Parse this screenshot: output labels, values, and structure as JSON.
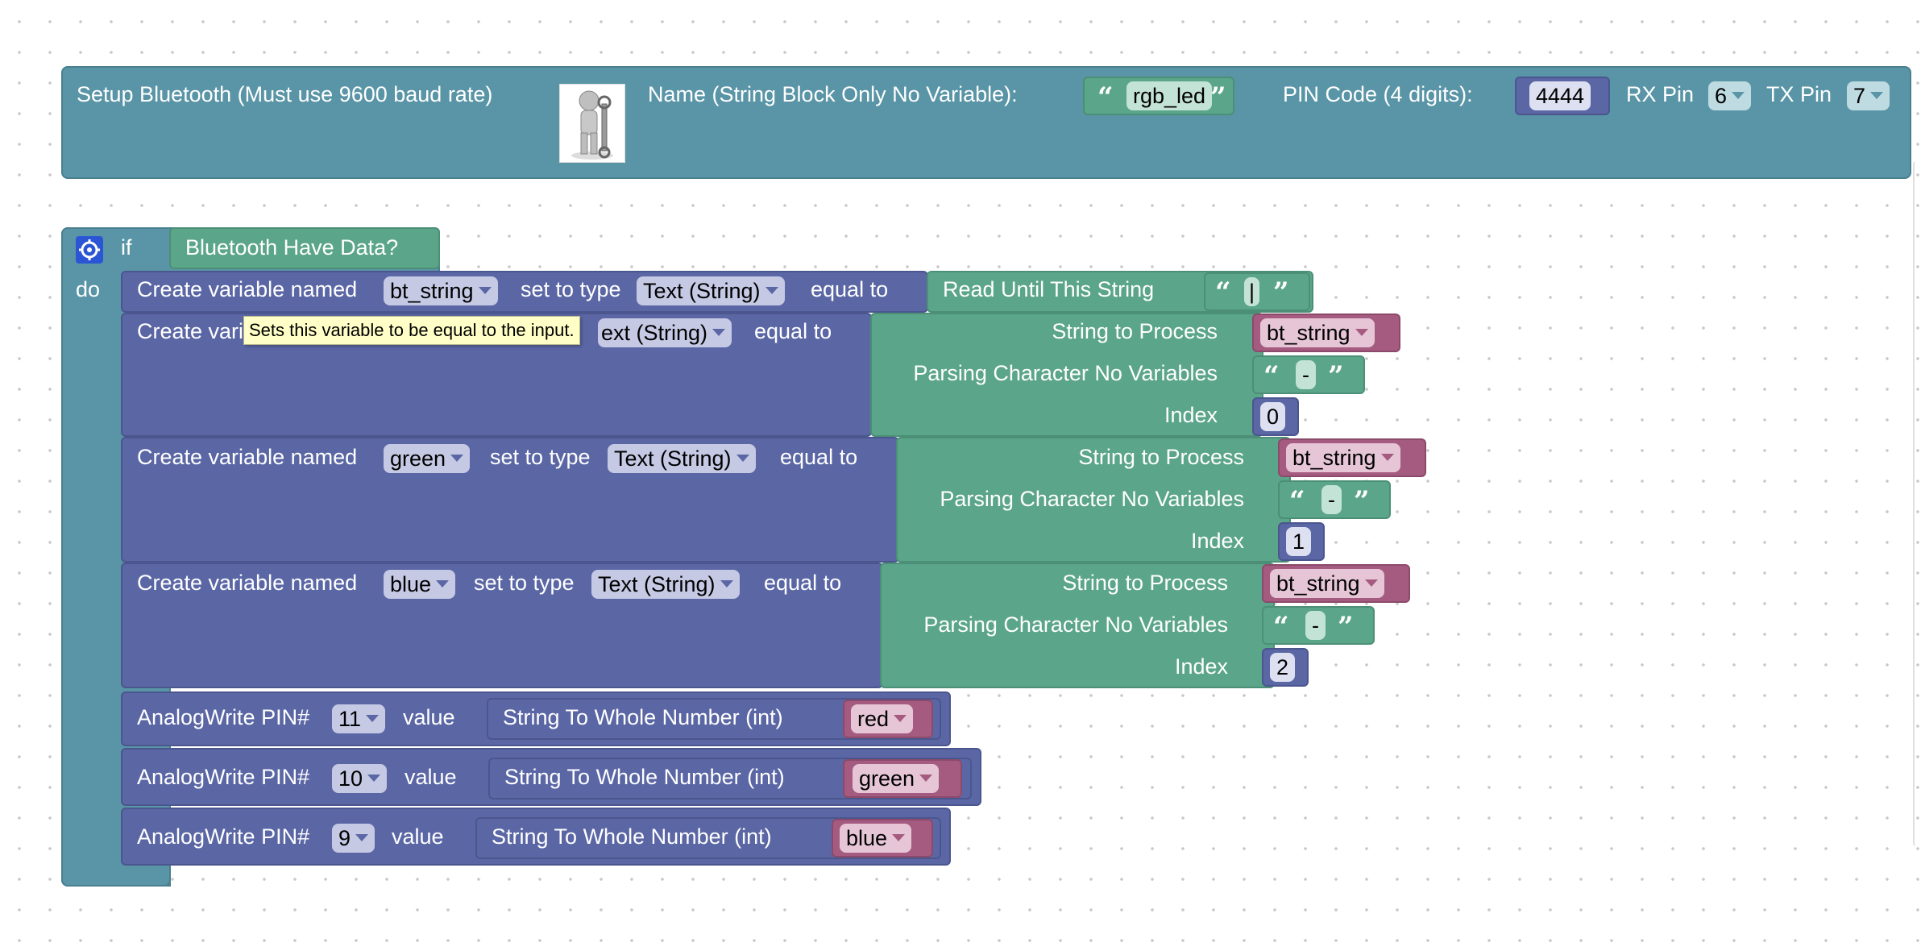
{
  "bluetooth_setup": {
    "title": "Setup Bluetooth (Must use 9600 baud rate)",
    "name_label": "Name (String Block Only No Variable):",
    "name_value": "rgb_led",
    "pin_code_label": "PIN Code (4 digits):",
    "pin_code_value": "4444",
    "rx_label": "RX Pin",
    "rx_value": "6",
    "tx_label": "TX Pin",
    "tx_value": "7"
  },
  "if_block": {
    "if_label": "if",
    "do_label": "do",
    "condition": "Bluetooth Have Data?"
  },
  "create_label": "Create variable named",
  "create_label_clipped": "Create vari",
  "set_type_label": "set to type",
  "equal_label": "equal to",
  "type_value": "Text (String)",
  "type_value_clipped": "ext (String)",
  "read_until": {
    "label": "Read Until This String",
    "value": "|"
  },
  "parse_labels": {
    "string": "String to Process",
    "char": "Parsing Character No Variables",
    "index": "Index"
  },
  "vars": [
    {
      "name": "bt_string"
    },
    {
      "name": "red",
      "source": "bt_string",
      "char": "-",
      "index": "0"
    },
    {
      "name": "green",
      "source": "bt_string",
      "char": "-",
      "index": "1"
    },
    {
      "name": "blue",
      "source": "bt_string",
      "char": "-",
      "index": "2"
    }
  ],
  "tooltip": "Sets this variable to be equal to the input.",
  "analog_write": {
    "label": "AnalogWrite PIN#",
    "value_label": "value",
    "convert_label": "String To Whole Number (int)",
    "rows": [
      {
        "pin": "11",
        "var": "red"
      },
      {
        "pin": "10",
        "var": "green"
      },
      {
        "pin": "9",
        "var": "blue"
      }
    ]
  },
  "colors": {
    "teal": "#5995a6",
    "blue": "#5b67a5",
    "green": "#5ba58b",
    "pink": "#a55b80",
    "tooltip": "#ffffc7"
  }
}
